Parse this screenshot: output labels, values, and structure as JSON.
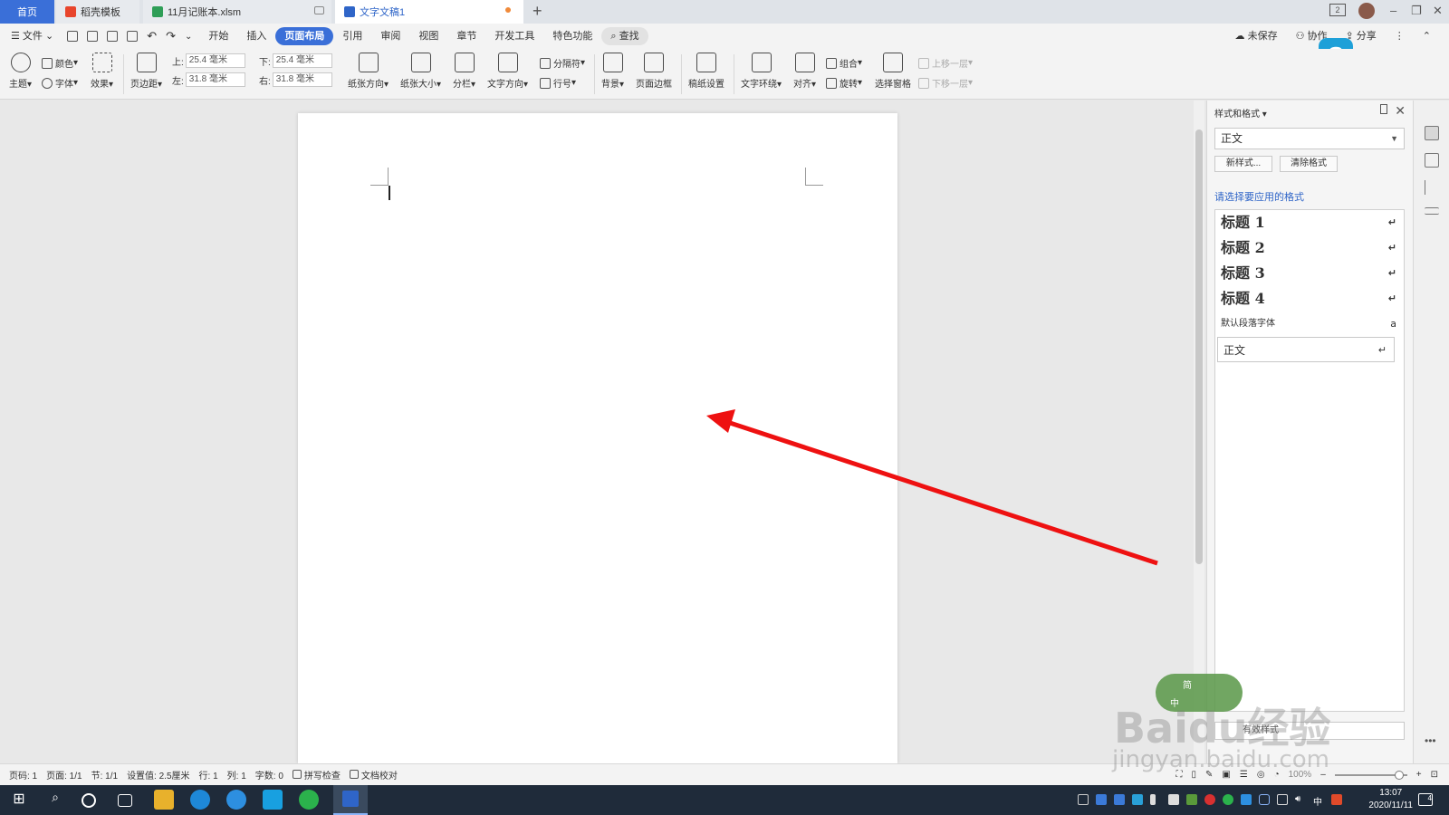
{
  "tabs": {
    "home": "首页",
    "template": "稻壳模板",
    "xlsx": "11月记账本.xlsm",
    "doc": "文字文稿1",
    "window_count": "2"
  },
  "menu": {
    "file": "文件",
    "items": [
      "开始",
      "插入",
      "页面布局",
      "引用",
      "审阅",
      "视图",
      "章节",
      "开发工具",
      "特色功能"
    ],
    "active": "页面布局",
    "search": "查找",
    "unsaved": "未保存",
    "collab": "协作",
    "share": "分享"
  },
  "toolbar": {
    "theme": "主题",
    "color": "颜色",
    "font": "字体",
    "effect": "效果",
    "margins": "页边距",
    "top_label": "上:",
    "top_value": "25.4 毫米",
    "bottom_label": "下:",
    "bottom_value": "25.4 毫米",
    "left_label": "左:",
    "left_value": "31.8 毫米",
    "right_label": "右:",
    "right_value": "31.8 毫米",
    "orientation": "纸张方向",
    "size": "纸张大小",
    "columns": "分栏",
    "text_dir": "文字方向",
    "breaks": "分隔符",
    "line_numbers": "行号",
    "background": "背景",
    "page_border": "页面边框",
    "draft_setup": "稿纸设置",
    "wrap": "文字环绕",
    "align": "对齐",
    "group": "组合",
    "rotate": "旋转",
    "select_pane": "选择窗格",
    "bring_forward": "上移一层",
    "send_backward": "下移一层"
  },
  "panel": {
    "title": "样式和格式",
    "current_style": "正文",
    "new_style": "新样式...",
    "clear_format": "清除格式",
    "choose": "请选择要应用的格式",
    "styles": [
      {
        "name": "标题 1",
        "mark": "↵"
      },
      {
        "name": "标题 2",
        "mark": "↵"
      },
      {
        "name": "标题 3",
        "mark": "↵"
      },
      {
        "name": "标题 4",
        "mark": "↵"
      },
      {
        "name": "默认段落字体",
        "mark": "a"
      },
      {
        "name": "正文",
        "mark": "↵"
      }
    ],
    "show": "有效样式"
  },
  "status": {
    "page_num": "页码: 1",
    "pages": "页面: 1/1",
    "section": "节: 1/1",
    "setting": "设置值: 2.5厘米",
    "row": "行: 1",
    "col": "列: 1",
    "words": "字数: 0",
    "spell": "拼写检查",
    "proof": "文档校对",
    "zoom": "100%"
  },
  "taskbar": {
    "time": "13:07",
    "date": "2020/11/11",
    "ime": "中",
    "notify_count": "4"
  },
  "watermark": {
    "brand": "Baidu经验",
    "url": "jingyan.baidu.com",
    "badge_top": "简",
    "badge_bottom": "中"
  },
  "colors": {
    "accent": "#3a6fd8",
    "arrow": "#ee1111",
    "taskbar": "#1f2b3a"
  }
}
